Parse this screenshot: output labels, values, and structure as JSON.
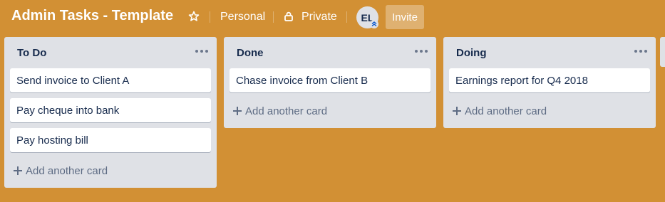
{
  "header": {
    "board_title": "Admin Tasks - Template",
    "team": "Personal",
    "visibility": "Private",
    "avatar_initials": "EL",
    "invite_label": "Invite"
  },
  "lists": [
    {
      "title": "To Do",
      "cards": [
        "Send invoice to Client A",
        "Pay cheque into bank",
        "Pay hosting bill"
      ],
      "add_label": "Add another card"
    },
    {
      "title": "Done",
      "cards": [
        "Chase invoice from Client B"
      ],
      "add_label": "Add another card"
    },
    {
      "title": "Doing",
      "cards": [
        "Earnings report for Q4 2018"
      ],
      "add_label": "Add another card"
    }
  ],
  "colors": {
    "board_background": "#d29034",
    "list_background": "#dfe1e6",
    "card_background": "#ffffff"
  }
}
